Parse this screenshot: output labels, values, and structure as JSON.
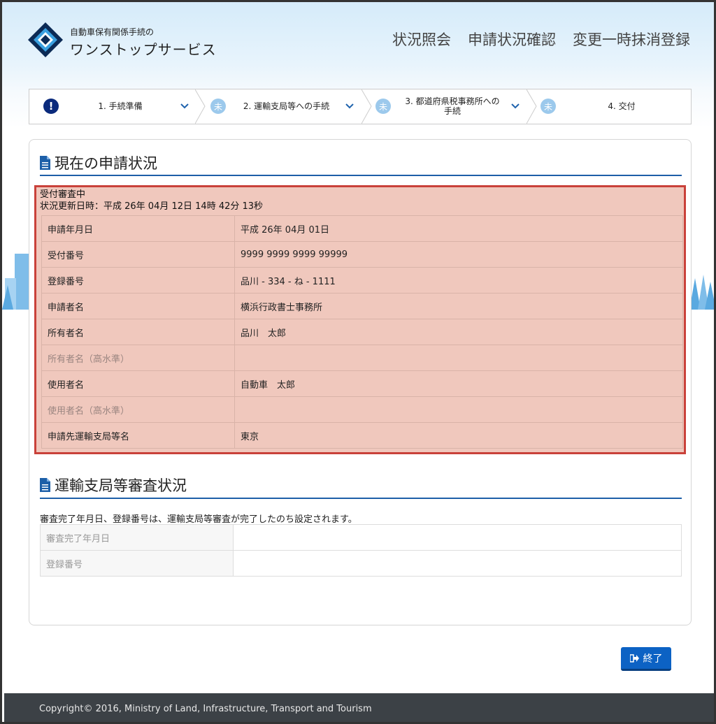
{
  "header": {
    "brand_small": "自動車保有関係手続の",
    "brand_big": "ワンストップサービス",
    "nav": [
      "状況照会",
      "申請状況確認",
      "変更一時抹消登録"
    ]
  },
  "steps": [
    {
      "label": "1. 手続準備",
      "icon": "!"
    },
    {
      "label": "2. 運輸支局等への手続",
      "icon": "未"
    },
    {
      "label": "3. 都道府県税事務所への手続",
      "label_line1": "3. 都道府県税事務所への",
      "label_line2": "手続",
      "icon": "未"
    },
    {
      "label": "4. 交付",
      "icon": "未"
    }
  ],
  "current": {
    "title": "現在の申請状況",
    "status": "受付審査中",
    "updated": "状況更新日時：平成 26年 04月 12日 14時 42分 13秒",
    "rows": [
      {
        "key": "申請年月日",
        "value": "平成 26年 04月 01日"
      },
      {
        "key": "受付番号",
        "value": "9999 9999 9999 99999"
      },
      {
        "key": "登録番号",
        "value": "品川 - 334 - ね - 1111"
      },
      {
        "key": "申請者名",
        "value": "横浜行政書士事務所"
      },
      {
        "key": "所有者名",
        "value": "品川　太郎"
      },
      {
        "key": "所有者名（高水準）",
        "value": ""
      },
      {
        "key": "使用者名",
        "value": "自動車　太郎"
      },
      {
        "key": "使用者名（高水準）",
        "value": ""
      },
      {
        "key": "申請先運輸支局等名",
        "value": "東京"
      }
    ]
  },
  "review": {
    "title": "運輸支局等審査状況",
    "note": "審査完了年月日、登録番号は、運輸支局等審査が完了したのち設定されます。",
    "rows": [
      {
        "key": "審査完了年月日",
        "value": ""
      },
      {
        "key": "登録番号",
        "value": ""
      }
    ]
  },
  "end_button": "終了",
  "footer": "Copyright© 2016, Ministry of Land, Infrastructure, Transport and Tourism",
  "colors": {
    "accent": "#0c62c4",
    "highlight_border": "#c9413a",
    "highlight_bg": "#f0c8bd",
    "title_rule": "#1d5fa8"
  }
}
